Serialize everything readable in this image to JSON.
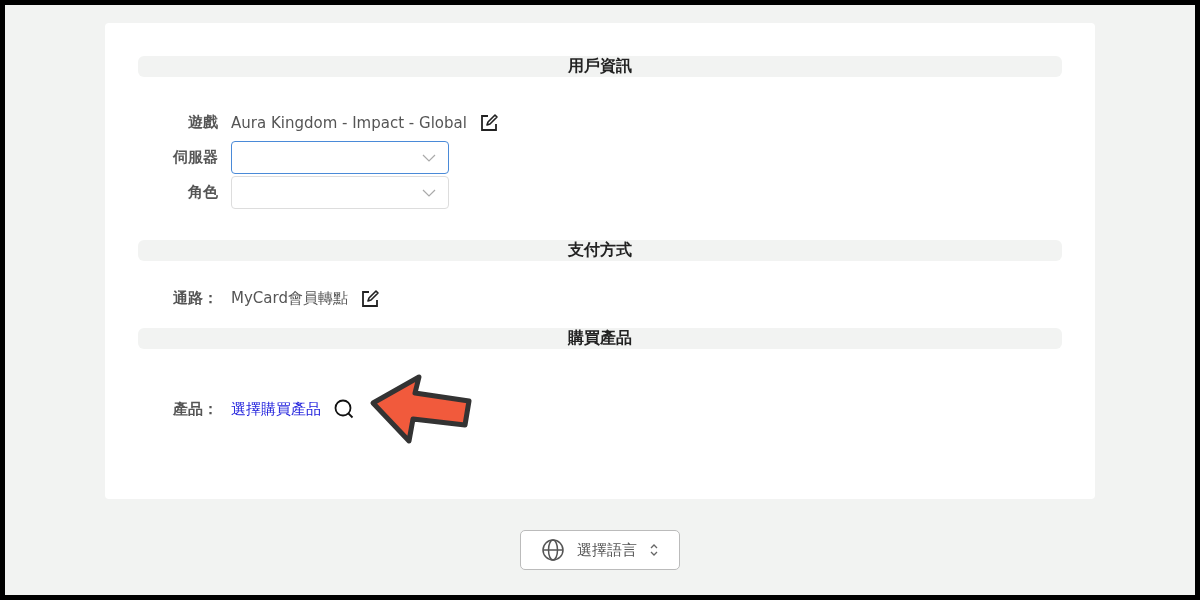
{
  "sections": [
    {
      "title": "用戶資訊",
      "rows": [
        {
          "kind": "text",
          "label": "遊戲",
          "value": "Aura Kingdom - Impact - Global",
          "editable": true
        },
        {
          "kind": "select",
          "label": "伺服器",
          "focused": true
        },
        {
          "kind": "select",
          "label": "角色",
          "focused": false
        }
      ]
    },
    {
      "title": "支付方式",
      "rows": [
        {
          "kind": "text",
          "label": "通路：",
          "value": "MyCard會員轉點",
          "editable": true
        }
      ]
    },
    {
      "title": "購買產品",
      "rows": [
        {
          "kind": "link",
          "label": "產品：",
          "value": "選擇購買產品"
        }
      ]
    }
  ],
  "language_button": {
    "label": "選擇語言"
  }
}
